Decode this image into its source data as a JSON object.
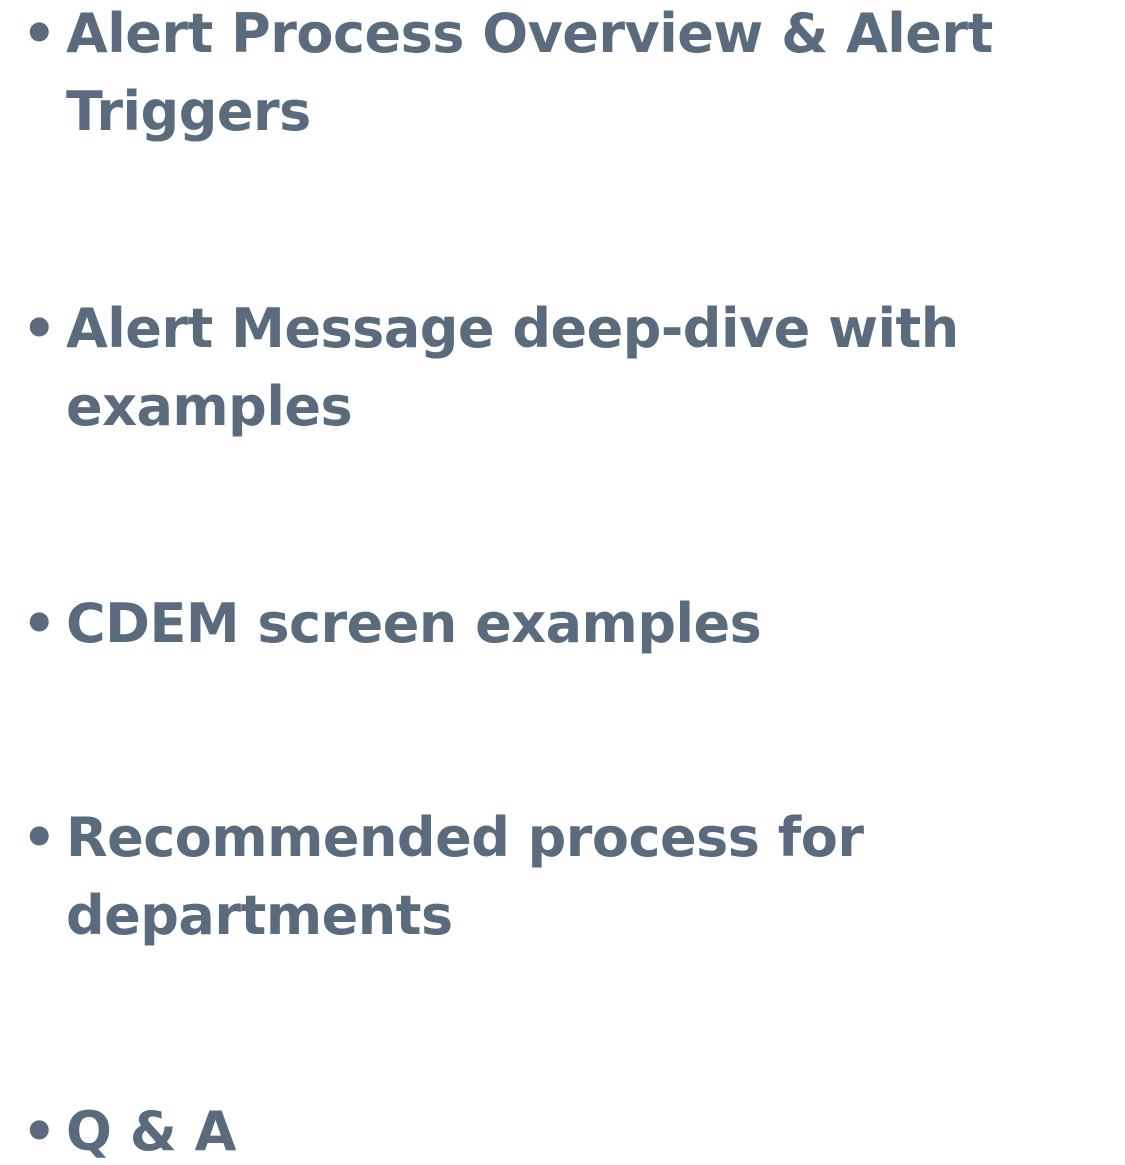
{
  "agenda": {
    "bullet": "•",
    "items": [
      {
        "label": "Alert Process Overview & Alert Triggers"
      },
      {
        "label": "Alert Message deep-dive with examples"
      },
      {
        "label": "CDEM screen examples"
      },
      {
        "label": "Recommended process for departments"
      },
      {
        "label": "Q & A"
      }
    ]
  },
  "colors": {
    "text": "#5a6b7d",
    "background": "#ffffff"
  }
}
